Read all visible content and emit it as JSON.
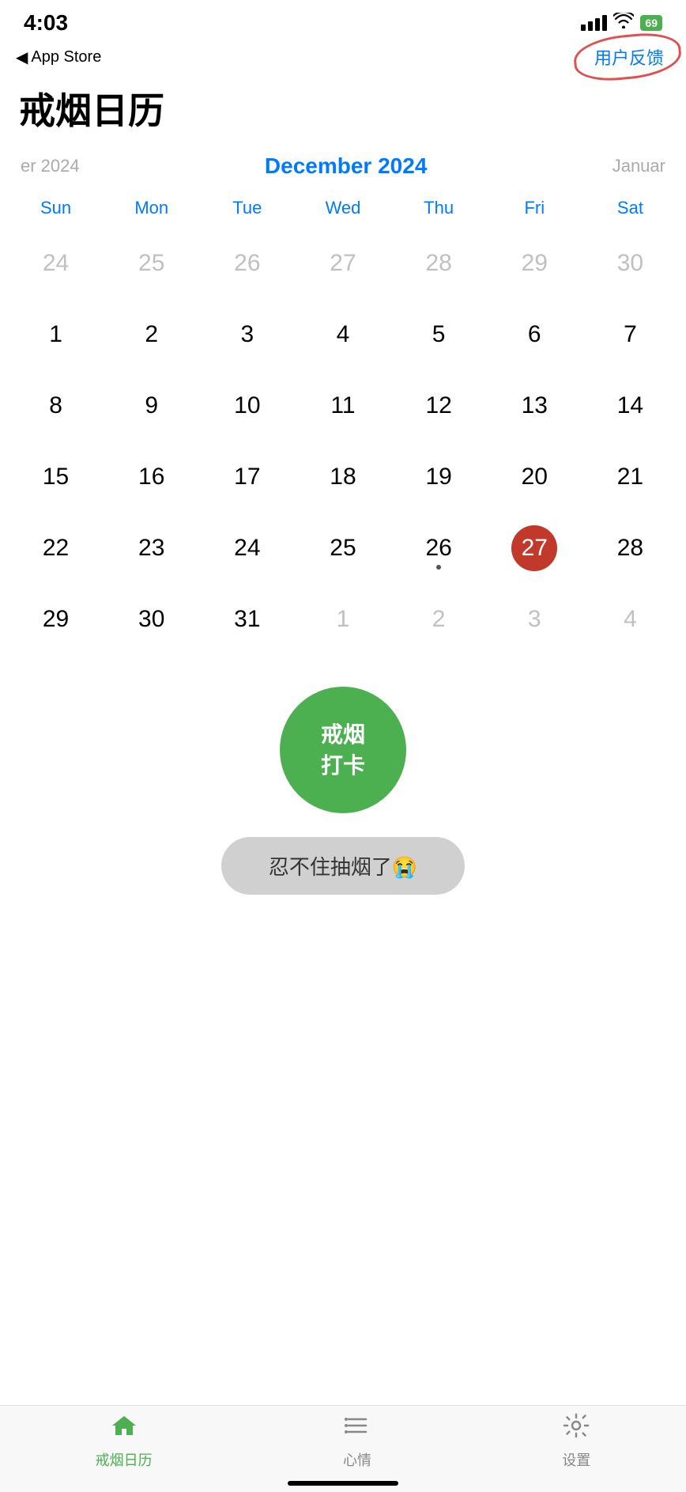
{
  "statusBar": {
    "time": "4:03",
    "battery": "69"
  },
  "nav": {
    "back": "App Store",
    "feedback": "用户反馈"
  },
  "page": {
    "title": "戒烟日历"
  },
  "calendar": {
    "prevMonth": "er 2024",
    "currentMonth": "December 2024",
    "nextMonth": "Januar",
    "dayHeaders": [
      "Sun",
      "Mon",
      "Tue",
      "Wed",
      "Thu",
      "Fri",
      "Sat"
    ],
    "weeks": [
      [
        {
          "num": "24",
          "outside": true
        },
        {
          "num": "25",
          "outside": true
        },
        {
          "num": "26",
          "outside": true
        },
        {
          "num": "27",
          "outside": true
        },
        {
          "num": "28",
          "outside": true
        },
        {
          "num": "29",
          "outside": true
        },
        {
          "num": "30",
          "outside": true
        }
      ],
      [
        {
          "num": "1",
          "outside": false
        },
        {
          "num": "2",
          "outside": false
        },
        {
          "num": "3",
          "outside": false
        },
        {
          "num": "4",
          "outside": false
        },
        {
          "num": "5",
          "outside": false
        },
        {
          "num": "6",
          "outside": false
        },
        {
          "num": "7",
          "outside": false
        }
      ],
      [
        {
          "num": "8",
          "outside": false
        },
        {
          "num": "9",
          "outside": false
        },
        {
          "num": "10",
          "outside": false
        },
        {
          "num": "11",
          "outside": false
        },
        {
          "num": "12",
          "outside": false
        },
        {
          "num": "13",
          "outside": false
        },
        {
          "num": "14",
          "outside": false
        }
      ],
      [
        {
          "num": "15",
          "outside": false
        },
        {
          "num": "16",
          "outside": false
        },
        {
          "num": "17",
          "outside": false
        },
        {
          "num": "18",
          "outside": false
        },
        {
          "num": "19",
          "outside": false
        },
        {
          "num": "20",
          "outside": false
        },
        {
          "num": "21",
          "outside": false
        }
      ],
      [
        {
          "num": "22",
          "outside": false
        },
        {
          "num": "23",
          "outside": false
        },
        {
          "num": "24",
          "outside": false
        },
        {
          "num": "25",
          "outside": false
        },
        {
          "num": "26",
          "outside": false,
          "dot": true
        },
        {
          "num": "27",
          "outside": false,
          "today": true
        },
        {
          "num": "28",
          "outside": false
        }
      ],
      [
        {
          "num": "29",
          "outside": false
        },
        {
          "num": "30",
          "outside": false
        },
        {
          "num": "31",
          "outside": false
        },
        {
          "num": "1",
          "outside": true
        },
        {
          "num": "2",
          "outside": true
        },
        {
          "num": "3",
          "outside": true
        },
        {
          "num": "4",
          "outside": true
        }
      ]
    ]
  },
  "actions": {
    "checkin": "戒烟\n打卡",
    "fail": "忍不住抽烟了😭"
  },
  "tabs": [
    {
      "id": "home",
      "label": "戒烟日历",
      "active": true
    },
    {
      "id": "mood",
      "label": "心情",
      "active": false
    },
    {
      "id": "settings",
      "label": "设置",
      "active": false
    }
  ]
}
